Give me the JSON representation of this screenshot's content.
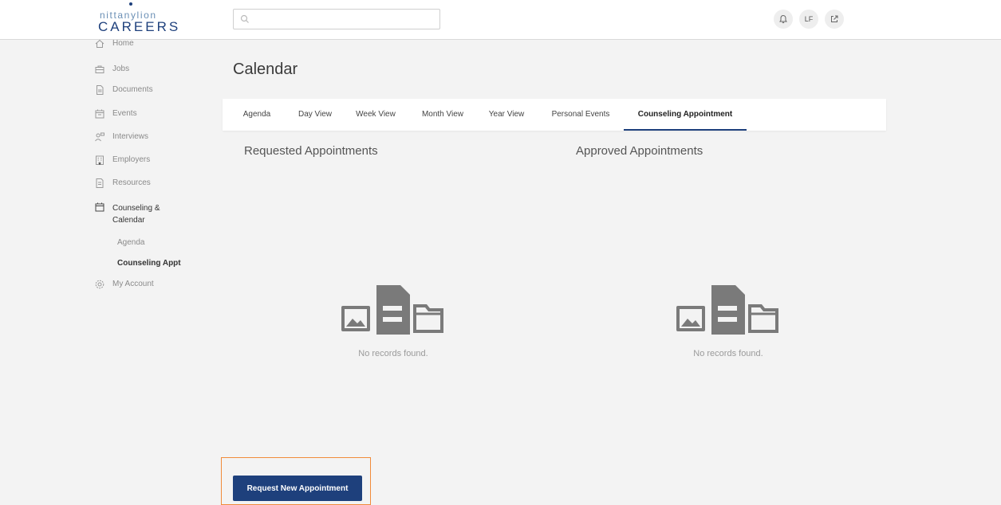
{
  "brand": {
    "line1": "nittanylion",
    "line2": "CAREERS"
  },
  "header": {
    "search_placeholder": "",
    "user_initials": "LF"
  },
  "sidebar": {
    "items": [
      {
        "label": "Home",
        "icon": "home-icon"
      },
      {
        "label": "Jobs",
        "icon": "briefcase-icon"
      },
      {
        "label": "Documents",
        "icon": "document-icon"
      },
      {
        "label": "Events",
        "icon": "calendar-icon"
      },
      {
        "label": "Interviews",
        "icon": "people-icon"
      },
      {
        "label": "Employers",
        "icon": "building-icon"
      },
      {
        "label": "Resources",
        "icon": "book-icon"
      },
      {
        "label": "Counseling & Calendar",
        "icon": "calendar-icon",
        "active": true
      },
      {
        "label": "My Account",
        "icon": "gear-icon"
      }
    ],
    "subitems": [
      {
        "label": "Agenda",
        "active": false
      },
      {
        "label": "Counseling Appt",
        "active": true
      }
    ]
  },
  "page": {
    "title": "Calendar",
    "tabs": [
      {
        "label": "Agenda"
      },
      {
        "label": "Day View"
      },
      {
        "label": "Week View"
      },
      {
        "label": "Month View"
      },
      {
        "label": "Year View"
      },
      {
        "label": "Personal Events"
      },
      {
        "label": "Counseling Appointment",
        "active": true
      }
    ],
    "requested": {
      "title": "Requested Appointments",
      "empty_text": "No records found."
    },
    "approved": {
      "title": "Approved Appointments",
      "empty_text": "No records found."
    },
    "request_button": "Request New Appointment"
  },
  "colors": {
    "brand_navy": "#1e407c",
    "highlight": "#f08b3a"
  }
}
